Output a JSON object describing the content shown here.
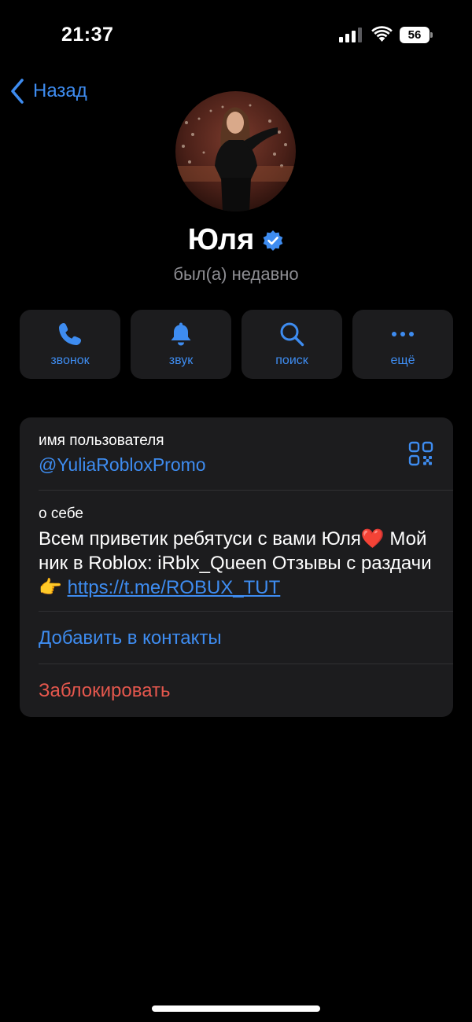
{
  "status_bar": {
    "time": "21:37",
    "battery": "56"
  },
  "nav": {
    "back_label": "Назад"
  },
  "profile": {
    "name": "Юля",
    "last_seen": "был(а) недавно"
  },
  "actions": [
    {
      "label": "звонок",
      "icon": "phone-icon"
    },
    {
      "label": "звук",
      "icon": "bell-icon"
    },
    {
      "label": "поиск",
      "icon": "search-icon"
    },
    {
      "label": "ещё",
      "icon": "more-icon"
    }
  ],
  "info": {
    "username_label": "имя пользователя",
    "username": "@YuliaRobloxPromo",
    "about_label": "о себе",
    "bio_text": "Всем приветик ребятуси с вами Юля❤️ Мой ник в Roblox: iRblx_Queen Отзывы с раздачи👉 ",
    "bio_link": "https://t.me/ROBUX_TUT",
    "add_contact": "Добавить в контакты",
    "block": "Заблокировать"
  },
  "colors": {
    "accent": "#3e8cf0",
    "danger": "#e5574d",
    "card": "#1c1c1e",
    "muted": "#8d8d92"
  }
}
